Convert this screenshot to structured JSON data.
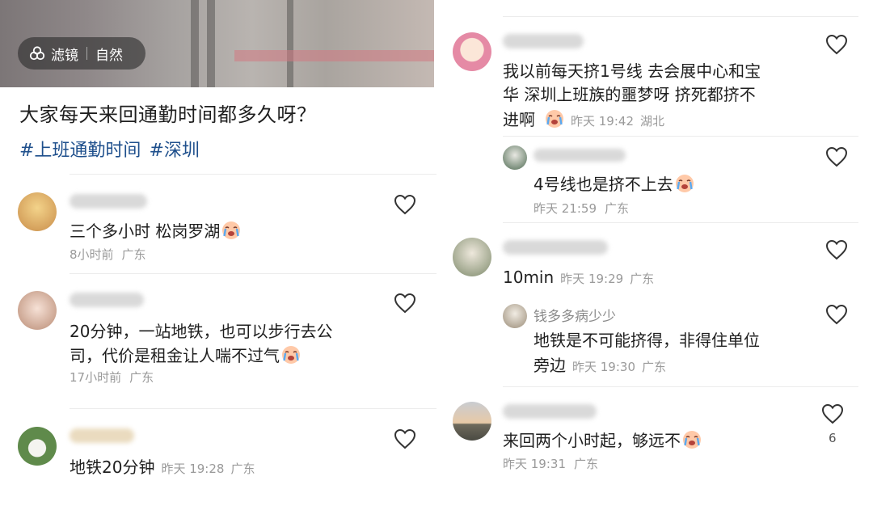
{
  "colors": {
    "tag": "#1e4f8c",
    "meta": "#9a9a9a",
    "text": "#1f1f1f",
    "chip_bg": "rgba(45,45,45,.62)"
  },
  "left": {
    "filter_chip": {
      "icon": "filter-icon",
      "label": "滤镜",
      "value": "自然"
    },
    "title": "大家每天来回通勤时间都多久呀？",
    "tags": [
      "#上班通勤时间",
      "#深圳"
    ],
    "comments": [
      {
        "text": "三个多小时 松岗罗湖",
        "emoji": "crying-emoji",
        "time": "8小时前",
        "location": "广东"
      },
      {
        "text_line1": "20分钟，一站地铁，也可以步行去公",
        "text_line2": "司，代价是租金让人喘不过气",
        "emoji": "crying-emoji",
        "time": "17小时前",
        "location": "广东"
      },
      {
        "text": "地铁20分钟",
        "time": "昨天 19:28",
        "location": "广东"
      }
    ]
  },
  "right": {
    "comments": [
      {
        "text_line1": "我以前每天挤1号线  去会展中心和宝",
        "text_line2": "华   深圳上班族的噩梦呀  挤死都挤不",
        "text_line3": "进啊",
        "emoji": "crying-emoji",
        "time": "昨天 19:42",
        "location": "湖北"
      },
      {
        "reply": true,
        "text": "4号线也是挤不上去",
        "emoji": "crying-emoji",
        "time": "昨天 21:59",
        "location": "广东"
      },
      {
        "text": "10min",
        "time": "昨天 19:29",
        "location": "广东"
      },
      {
        "reply": true,
        "name": "钱多多病少少",
        "text_line1": "地铁是不可能挤得，非得住单位",
        "text_line2": "旁边",
        "time": "昨天 19:30",
        "location": "广东"
      },
      {
        "text": "来回两个小时起，够远不",
        "emoji": "crying-emoji",
        "time": "昨天 19:31",
        "location": "广东",
        "likes": "6"
      }
    ]
  }
}
